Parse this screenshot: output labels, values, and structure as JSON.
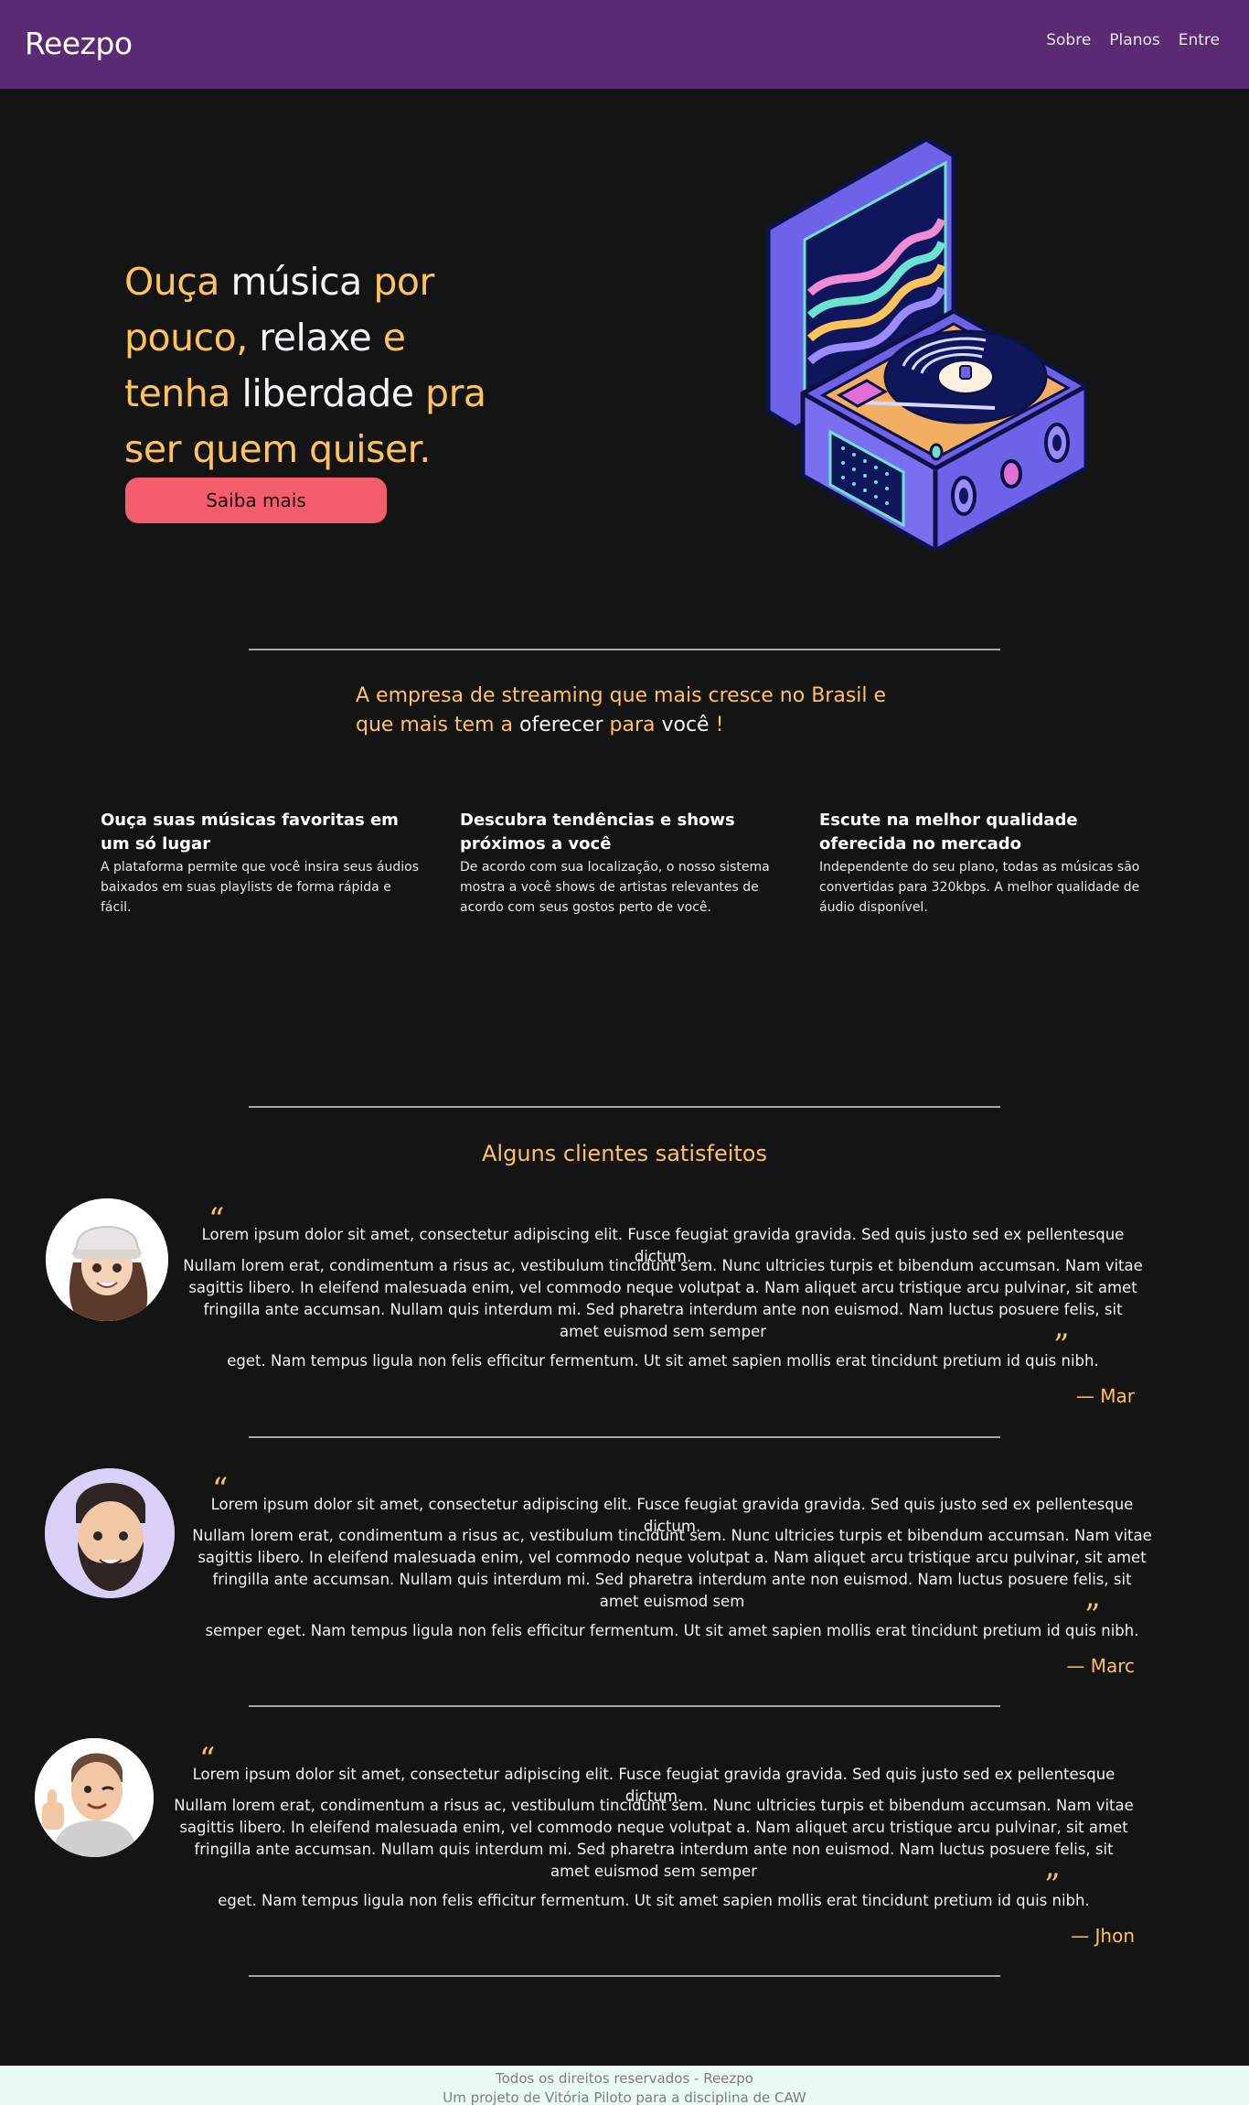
{
  "nav": {
    "brand": "Reezpo",
    "links": [
      "Sobre",
      "Planos",
      "Entre"
    ]
  },
  "hero": {
    "title_parts": [
      {
        "text": "Ouça ",
        "tone": "yellow"
      },
      {
        "text": "música ",
        "tone": "white"
      },
      {
        "text": "por pouco, ",
        "tone": "yellow"
      },
      {
        "text": "relaxe ",
        "tone": "white"
      },
      {
        "text": "e tenha ",
        "tone": "yellow"
      },
      {
        "text": "liberdade ",
        "tone": "white"
      },
      {
        "text": "pra ser quem quiser.",
        "tone": "yellow"
      }
    ],
    "button_label": "Saiba mais",
    "illustration_icon": "turntable-icon"
  },
  "company": {
    "title_parts": [
      {
        "text": "A empresa de streaming que mais cresce no Brasil e que mais tem a ",
        "tone": "yellow"
      },
      {
        "text": "oferecer ",
        "tone": "white"
      },
      {
        "text": "para ",
        "tone": "yellow"
      },
      {
        "text": "você",
        "tone": "white"
      },
      {
        "text": " !",
        "tone": "yellow"
      }
    ]
  },
  "features": [
    {
      "title": "Ouça suas músicas favoritas em um só lugar",
      "text": "A plataforma permite que você insira seus áudios baixados em suas playlists de forma rápida e fácil."
    },
    {
      "title": "Descubra tendências e shows próximos a você",
      "text": "De acordo com sua localização, o nosso sistema mostra a você shows de artistas relevantes de acordo com seus gostos perto de você."
    },
    {
      "title": "Escute na melhor qualidade oferecida no mercado",
      "text": "Independente do seu plano, todas as músicas são convertidas para 320kbps. A melhor qualidade de áudio disponível."
    }
  ],
  "clients": {
    "title": "Alguns clientes satisfeitos",
    "items": [
      {
        "first": "Lorem ipsum dolor sit amet, consectetur adipiscing elit. Fusce feugiat gravida gravida. Sed quis justo sed ex pellentesque dictum.",
        "middle": "Nullam lorem erat, condimentum a risus ac, vestibulum tincidunt sem. Nunc ultricies turpis et bibendum accumsan. Nam vitae sagittis libero. In eleifend malesuada enim, vel commodo neque volutpat a. Nam aliquet arcu tristique arcu pulvinar, sit amet fringilla ante accumsan. Nullam quis interdum mi. Sed pharetra interdum ante non euismod. Nam luctus posuere felis, sit amet euismod sem semper",
        "last": "eget. Nam tempus ligula non felis efficitur fermentum. Ut sit amet sapien mollis erat tincidunt pretium id quis nibh.",
        "author": "— Mar",
        "avatar_icon": "girl-avatar-icon"
      },
      {
        "first": "Lorem ipsum dolor sit amet, consectetur adipiscing elit. Fusce feugiat gravida gravida. Sed quis justo sed ex pellentesque dictum.",
        "middle": "Nullam lorem erat, condimentum a risus ac, vestibulum tincidunt sem. Nunc ultricies turpis et bibendum accumsan. Nam vitae sagittis libero. In eleifend malesuada enim, vel commodo neque volutpat a. Nam aliquet arcu tristique arcu pulvinar, sit amet fringilla ante accumsan. Nullam quis interdum mi. Sed pharetra interdum ante non euismod. Nam luctus posuere felis, sit amet euismod sem",
        "last": "semper eget. Nam tempus ligula non felis efficitur fermentum. Ut sit amet sapien mollis erat tincidunt pretium id quis nibh.",
        "author": "— Marc",
        "avatar_icon": "bearded-man-avatar-icon"
      },
      {
        "first": "Lorem ipsum dolor sit amet, consectetur adipiscing elit. Fusce feugiat gravida gravida. Sed quis justo sed ex pellentesque dictum.",
        "middle": "Nullam lorem erat, condimentum a risus ac, vestibulum tincidunt sem. Nunc ultricies turpis et bibendum accumsan. Nam vitae sagittis libero. In eleifend malesuada enim, vel commodo neque volutpat a. Nam aliquet arcu tristique arcu pulvinar, sit amet fringilla ante accumsan. Nullam quis interdum mi. Sed pharetra interdum ante non euismod. Nam luctus posuere felis, sit amet euismod sem semper",
        "last": "eget. Nam tempus ligula non felis efficitur fermentum. Ut sit amet sapien mollis erat tincidunt pretium id quis nibh.",
        "author": "— Jhon",
        "avatar_icon": "thumbs-up-man-avatar-icon"
      }
    ]
  },
  "footer": {
    "line1": "Todos os direitos reservados - Reezpo",
    "line2": "Um projeto de Vitória Piloto para a disciplina de CAW"
  },
  "colors": {
    "nav_bg": "#5a2a73",
    "page_bg": "#141414",
    "accent_yellow": "#ffc35c",
    "button_pink": "#f25e6b",
    "footer_bg": "#e9fbf2"
  }
}
